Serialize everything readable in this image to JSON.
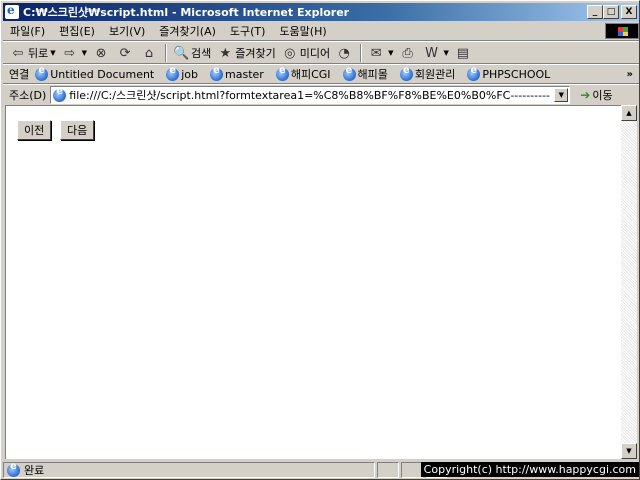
{
  "window": {
    "title": "C:₩스크린샷₩script.html - Microsoft Internet Explorer",
    "buttons": {
      "minimize": "_",
      "maximize": "□",
      "close": "X"
    }
  },
  "menu": [
    "파일(F)",
    "편집(E)",
    "보기(V)",
    "즐겨찾기(A)",
    "도구(T)",
    "도움말(H)"
  ],
  "toolbar": {
    "back": "뒤로",
    "search": "검색",
    "favorites": "즐겨찾기",
    "media": "미디어"
  },
  "links": {
    "label": "연결",
    "items": [
      "Untitled Document",
      "job",
      "master",
      "해피CGI",
      "해피몰",
      "회원관리",
      "PHPSCHOOL"
    ],
    "more": "»"
  },
  "address": {
    "label": "주소(D)",
    "value": "file:///C:/스크린샷/script.html?formtextarea1=%C8%B8%BF%F8%BE%E0%B0%FC----------",
    "go": "이동"
  },
  "content": {
    "prev_button": "이전",
    "next_button": "다음"
  },
  "status": {
    "text": "완료",
    "copyright": "Copyright(c) http://www.happycgi.com"
  }
}
